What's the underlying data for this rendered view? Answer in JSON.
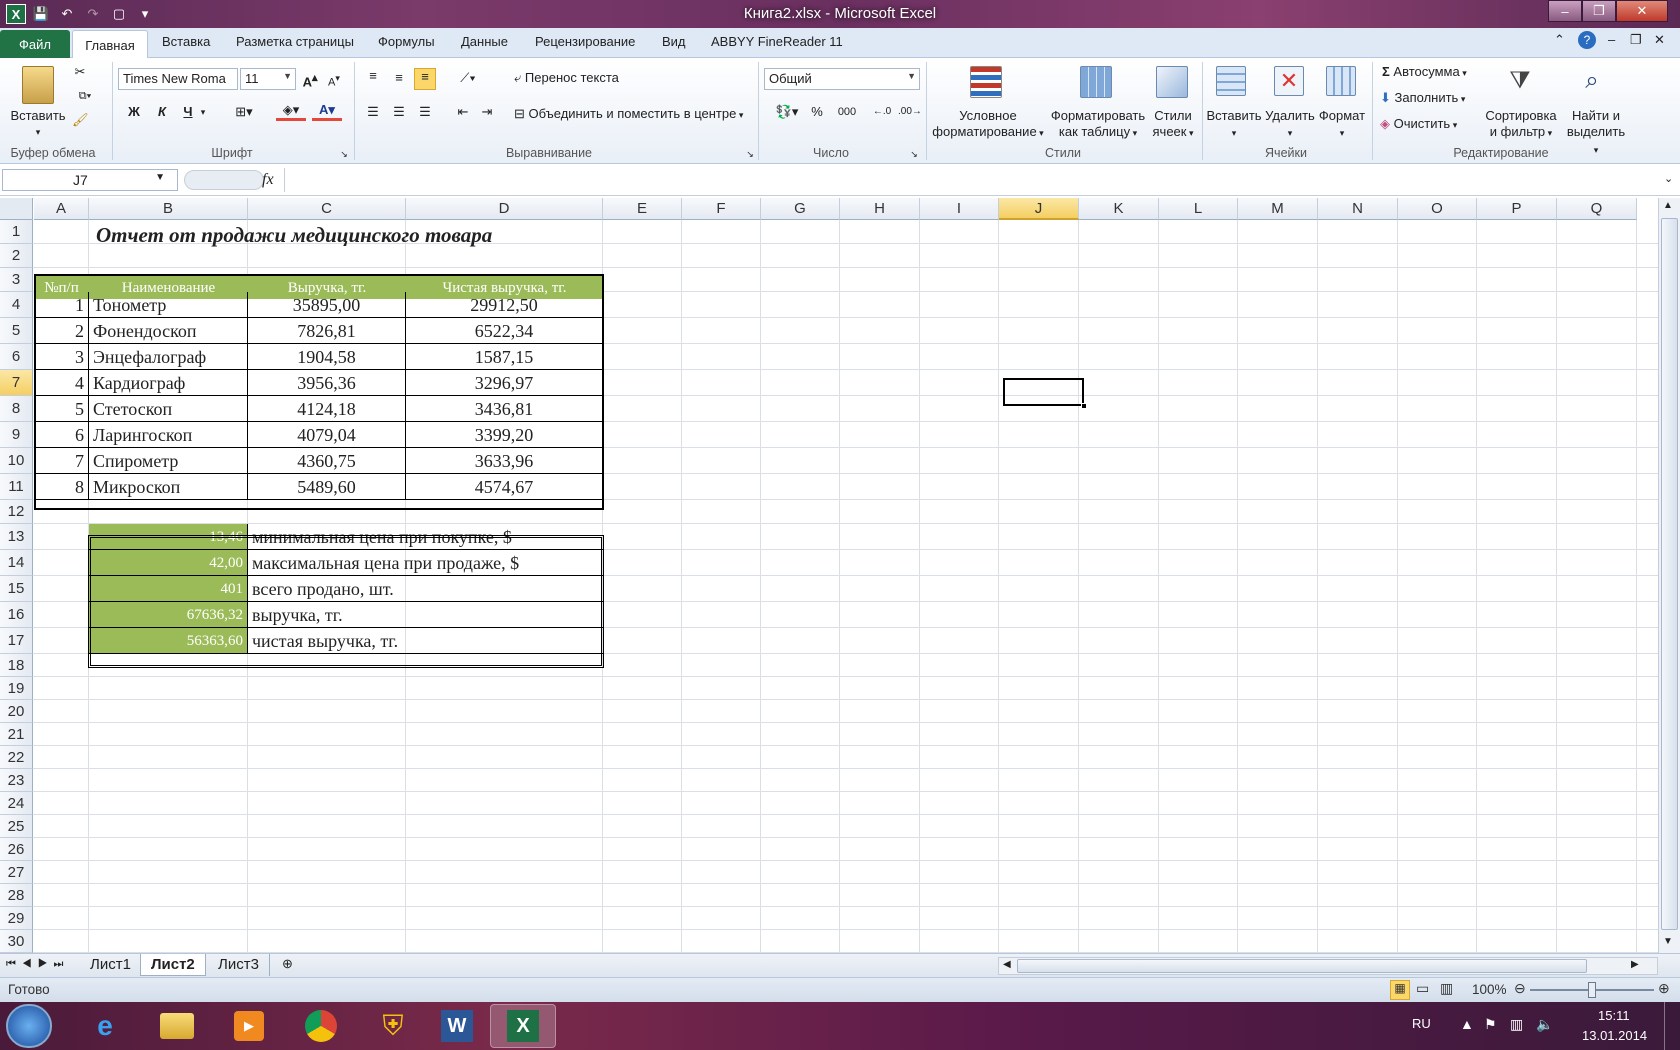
{
  "window": {
    "title": "Книга2.xlsx  -  Microsoft Excel",
    "minimize": "–",
    "maximize": "❐",
    "close": "✕"
  },
  "ribbon_tabs": [
    "Файл",
    "Главная",
    "Вставка",
    "Разметка страницы",
    "Формулы",
    "Данные",
    "Рецензирование",
    "Вид",
    "ABBYY FineReader 11"
  ],
  "ribbon": {
    "clipboard": {
      "paste": "Вставить",
      "label": "Буфер обмена"
    },
    "font": {
      "name": "Times New Roma",
      "size": "11",
      "bold": "Ж",
      "italic": "К",
      "underline": "Ч",
      "label": "Шрифт"
    },
    "alignment": {
      "wrap": "Перенос текста",
      "merge": "Объединить и поместить в центре",
      "label": "Выравнивание"
    },
    "number": {
      "format": "Общий",
      "percent": "%",
      "thousands": "000",
      "label": "Число"
    },
    "styles": {
      "conditional_1": "Условное",
      "conditional_2": "форматирование",
      "format_table_1": "Форматировать",
      "format_table_2": "как таблицу",
      "cell_styles_1": "Стили",
      "cell_styles_2": "ячеек",
      "label": "Стили"
    },
    "cells": {
      "insert": "Вставить",
      "delete": "Удалить",
      "format": "Формат",
      "label": "Ячейки"
    },
    "editing": {
      "autosum": "Автосумма",
      "fill": "Заполнить",
      "clear": "Очистить",
      "sort_1": "Сортировка",
      "sort_2": "и фильтр",
      "find_1": "Найти и",
      "find_2": "выделить",
      "label": "Редактирование"
    }
  },
  "formula_bar": {
    "name_box": "J7",
    "fx": "fx",
    "formula": ""
  },
  "columns": [
    "A",
    "B",
    "C",
    "D",
    "E",
    "F",
    "G",
    "H",
    "I",
    "J",
    "K",
    "L",
    "M",
    "N",
    "O",
    "P",
    "Q"
  ],
  "rows": [
    "1",
    "2",
    "3",
    "4",
    "5",
    "6",
    "7",
    "8",
    "9",
    "10",
    "11",
    "12",
    "13",
    "14",
    "15",
    "16",
    "17",
    "18",
    "19",
    "20",
    "21",
    "22",
    "23",
    "24",
    "25",
    "26",
    "27",
    "28",
    "29",
    "30"
  ],
  "sheet": {
    "title": "Отчет от продажи медицинского товара",
    "table_headers": [
      "№п/п",
      "Наименование",
      "Выручка, тг.",
      "Чистая выручка, тг."
    ],
    "table_rows": [
      [
        "1",
        "Тонометр",
        "35895,00",
        "29912,50"
      ],
      [
        "2",
        "Фонендоскоп",
        "7826,81",
        "6522,34"
      ],
      [
        "3",
        "Энцефалограф",
        "1904,58",
        "1587,15"
      ],
      [
        "4",
        "Кардиограф",
        "3956,36",
        "3296,97"
      ],
      [
        "5",
        "Стетоскоп",
        "4124,18",
        "3436,81"
      ],
      [
        "6",
        "Ларингоскоп",
        "4079,04",
        "3399,20"
      ],
      [
        "7",
        "Спирометр",
        "4360,75",
        "3633,96"
      ],
      [
        "8",
        "Микроскоп",
        "5489,60",
        "4574,67"
      ]
    ],
    "summary": [
      [
        "13,46",
        "минимальная цена при покупке, $"
      ],
      [
        "42,00",
        "максимальная цена при продаже, $"
      ],
      [
        "401",
        "всего продано, шт."
      ],
      [
        "67636,32",
        "выручка, тг."
      ],
      [
        "56363,60",
        "чистая выручка, тг."
      ]
    ]
  },
  "sheet_tabs": [
    "Лист1",
    "Лист2",
    "Лист3"
  ],
  "status": {
    "ready": "Готово",
    "zoom": "100%"
  },
  "taskbar": {
    "lang": "RU",
    "time": "15:11",
    "date": "13.01.2014"
  },
  "colors": {
    "accent_green": "#9bbb59",
    "excel_green": "#217346"
  }
}
